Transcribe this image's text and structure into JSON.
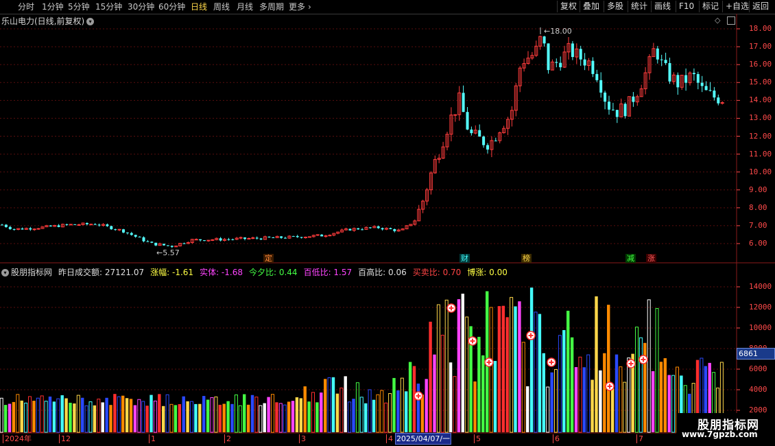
{
  "toolbar": {
    "periods": [
      "分时",
      "1分钟",
      "5分钟",
      "15分钟",
      "30分钟",
      "60分钟",
      "日线",
      "周线",
      "月线",
      "多周期",
      "更多"
    ],
    "active": "日线",
    "right_buttons": [
      "复权",
      "叠加",
      "多股",
      "统计",
      "画线",
      "F10",
      "标记",
      "+自选",
      "返回"
    ]
  },
  "header": {
    "title": "乐山电力(日线,前复权)"
  },
  "main_chart": {
    "high_label": "18.00",
    "low_label": "5.57",
    "price_ticks": [
      "18.00",
      "17.00",
      "16.00",
      "15.00",
      "14.00",
      "13.00",
      "12.00",
      "11.00",
      "10.00",
      "9.00",
      "8.00",
      "7.00",
      "6.00"
    ],
    "event_tags": [
      "定",
      "财",
      "榜",
      "减",
      "涨"
    ]
  },
  "indicator": {
    "name": "股朋指标网",
    "items": [
      {
        "label": "昨日成交额:",
        "value": "27121.07",
        "color": "#e0e0e0"
      },
      {
        "label": "涨幅:",
        "value": "-1.61",
        "color": "#ffff44"
      },
      {
        "label": "实体:",
        "value": "-1.68",
        "color": "#ff44ff"
      },
      {
        "label": "今夕比:",
        "value": "0.44",
        "color": "#44ff44"
      },
      {
        "label": "百低比:",
        "value": "1.57",
        "color": "#ff44ff"
      },
      {
        "label": "百高比:",
        "value": "0.06",
        "color": "#e0e0e0"
      },
      {
        "label": "买卖比:",
        "value": "0.70",
        "color": "#ff4444"
      },
      {
        "label": "博涨:",
        "value": "0.00",
        "color": "#ffff44"
      }
    ],
    "volume_ticks": [
      "14000",
      "12000",
      "10000",
      "8000",
      "6000",
      "4000",
      "2000"
    ],
    "cursor_value": "6861"
  },
  "xaxis": {
    "labels": [
      "2024年",
      "12",
      "1",
      "2",
      "3",
      "4",
      "5",
      "6",
      "7"
    ],
    "cursor_date": "2025/04/07/一"
  },
  "watermark": {
    "line1": "股朋指标网",
    "line2": "www.7gpzb.com"
  },
  "colors": {
    "up": "#ff3c3c",
    "down": "#54ffff",
    "axis": "#ff4a4a",
    "grid": "#6a1010"
  }
}
